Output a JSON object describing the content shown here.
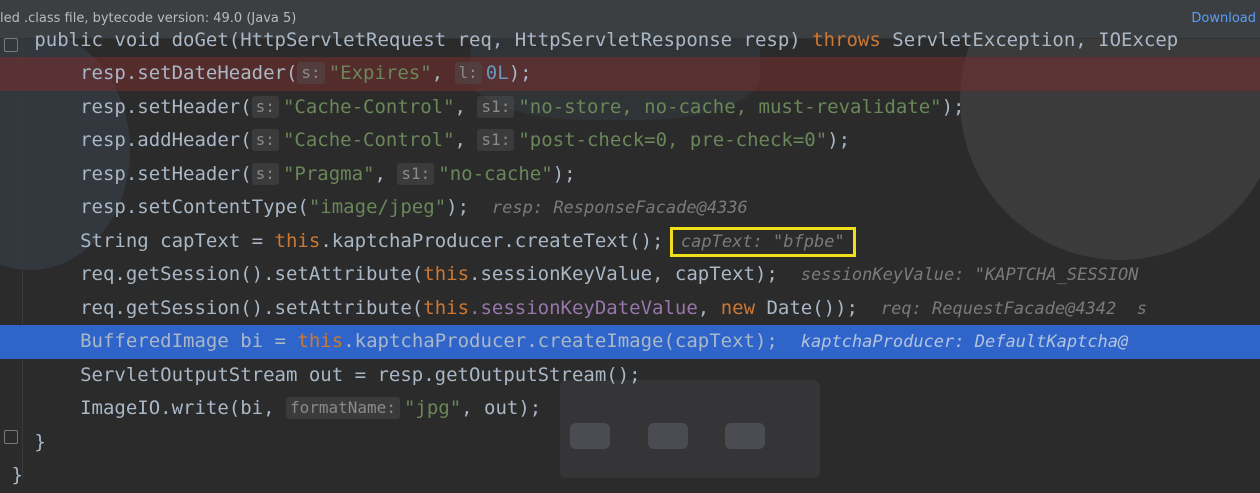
{
  "banner": {
    "text": "led .class file, bytecode version: 49.0 (Java 5)",
    "link": "Download"
  },
  "code": {
    "line0": {
      "pre": "   public void doGet(HttpServletRequest req, HttpServletResponse resp) ",
      "kw": "throws",
      "post": " ServletException, IOExcep"
    },
    "line1": {
      "a": "       resp.setDateHeader(",
      "h1": "s:",
      "s1": "\"Expires\"",
      "c": ", ",
      "h2": "l:",
      "n": "0L",
      "e": ");"
    },
    "line2": {
      "a": "       resp.setHeader(",
      "h1": "s:",
      "s1": "\"Cache-Control\"",
      "c": ", ",
      "h2": "s1:",
      "s2": "\"no-store, no-cache, must-revalidate\"",
      "e": ");"
    },
    "line3": {
      "a": "       resp.addHeader(",
      "h1": "s:",
      "s1": "\"Cache-Control\"",
      "c": ", ",
      "h2": "s1:",
      "s2": "\"post-check=0, pre-check=0\"",
      "e": ");"
    },
    "line4": {
      "a": "       resp.setHeader(",
      "h1": "s:",
      "s1": "\"Pragma\"",
      "c": ", ",
      "h2": "s1:",
      "s2": "\"no-cache\"",
      "e": ");"
    },
    "line5": {
      "a": "       resp.setContentType(",
      "s1": "\"image/jpeg\"",
      "e": ");  ",
      "v": "resp: ResponseFacade@4336"
    },
    "line6": {
      "a": "       String capText = ",
      "kw": "this",
      "b": ".kaptchaProducer.createText(); ",
      "v": "capText: \"bfpbe\""
    },
    "line7": {
      "a": "       req.getSession().setAttribute(",
      "kw": "this",
      "b": ".sessionKeyValue, capText);  ",
      "v": "sessionKeyValue: \"KAPTCHA_SESSION"
    },
    "line8": {
      "a": "       req.getSession().setAttribute(",
      "kw": "this",
      "fld": ".sessionKeyDateValue",
      "b": ", ",
      "kw2": "new",
      "c": " Date());  ",
      "v": "req: RequestFacade@4342  s"
    },
    "line9": {
      "a": "       BufferedImage bi = ",
      "kw": "this",
      "b": ".kaptchaProducer.createImage(capText);  ",
      "v": "kaptchaProducer: DefaultKaptcha@"
    },
    "line10": {
      "a": "       ServletOutputStream out = resp.getOutputStream();"
    },
    "line11": {
      "a": "       ImageIO.write(bi, ",
      "h1": "formatName:",
      "s1": "\"jpg\"",
      "e": ", out);"
    },
    "line12": {
      "a": "   }"
    },
    "line13": {
      "a": " }"
    }
  },
  "colors": {
    "keyword": "#cc7832",
    "string": "#6a8759",
    "number": "#6897bb",
    "field": "#9876aa",
    "execution_line": "#2f65ca",
    "breakpoint_line": "#7a2d2d",
    "highlight_box": "#f0e01a"
  }
}
